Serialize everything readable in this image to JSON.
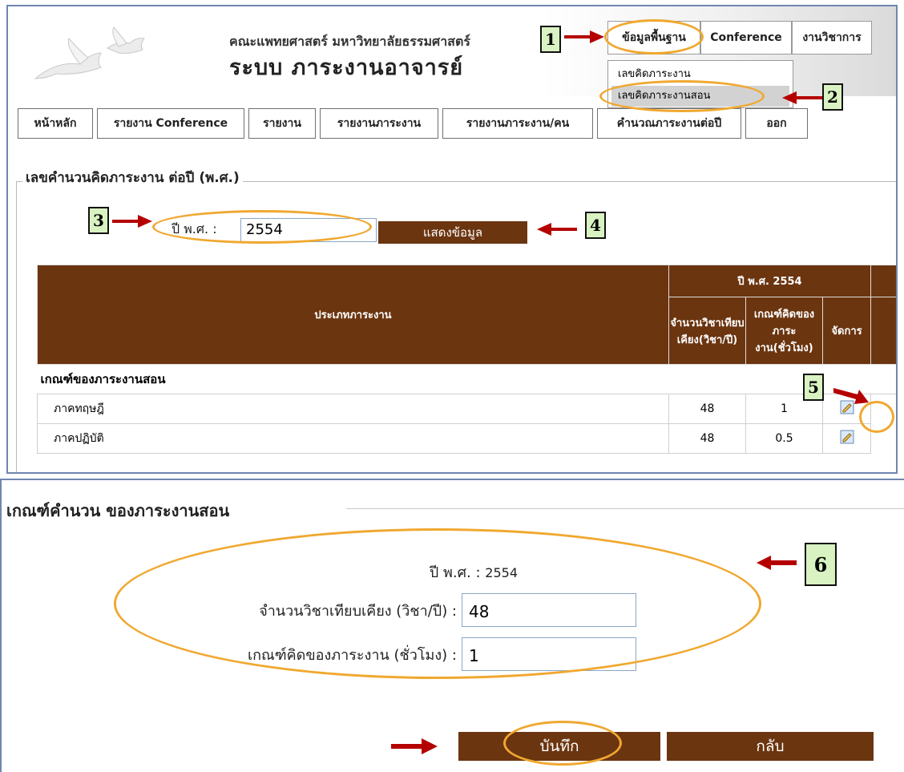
{
  "header": {
    "faculty": "คณะแพทยศาสตร์ มหาวิทยาลัยธรรมศาสตร์",
    "system_title": "ระบบ ภาระงานอาจารย์"
  },
  "top_menu": {
    "basic_data": "ข้อมูลพื้นฐาน",
    "conference": "Conference",
    "academic": "งานวิชาการ"
  },
  "dropdown": {
    "item1": "เลขคิดภาระงาน",
    "item2": "เลขคิดภาระงานสอน"
  },
  "nav": [
    "หน้าหลัก",
    "รายงาน Conference",
    "รายงาน",
    "รายงานภาระงาน",
    "รายงานภาระงาน/คน",
    "คำนวณภาระงานต่อปี",
    "ออก"
  ],
  "section1": {
    "legend": "เลขคำนวนคิดภาระงาน ต่อปี (พ.ศ.)",
    "year_label": "ปี พ.ศ. :",
    "year_value": "2554",
    "show_button": "แสดงข้อมูล"
  },
  "table": {
    "col_type": "ประเภทภาระงาน",
    "year_header": "ปี พ.ศ. 2554",
    "col_count": "จำนวนวิชาเทียบเคียง(วิชา/ปี)",
    "col_criteria": "เกณฑ์คิดของภาระงาน(ชั่วโมง)",
    "col_manage": "จัดการ",
    "group_title": "เกณฑ์ของภาระงานสอน",
    "rows": [
      {
        "name": "ภาคทฤษฎี",
        "count": "48",
        "criteria": "1"
      },
      {
        "name": "ภาคปฏิบัติ",
        "count": "48",
        "criteria": "0.5"
      }
    ]
  },
  "section2": {
    "title": "เกณฑ์คำนวน ของภาระงานสอน",
    "year_label": "ปี พ.ศ. :",
    "year_value": "2554",
    "count_label": "จำนวนวิชาเทียบเคียง (วิชา/ปี) :",
    "count_value": "48",
    "criteria_label": "เกณฑ์คิดของภาระงาน (ชั่วโมง) :",
    "criteria_value": "1",
    "save_button": "บันทึก",
    "back_button": "กลับ"
  },
  "callouts": [
    "1",
    "2",
    "3",
    "4",
    "5",
    "6"
  ],
  "colors": {
    "brown": "#6b3510",
    "highlight": "#f0a830",
    "arrow": "#b50000",
    "callout_bg": "#d9f2c2"
  }
}
